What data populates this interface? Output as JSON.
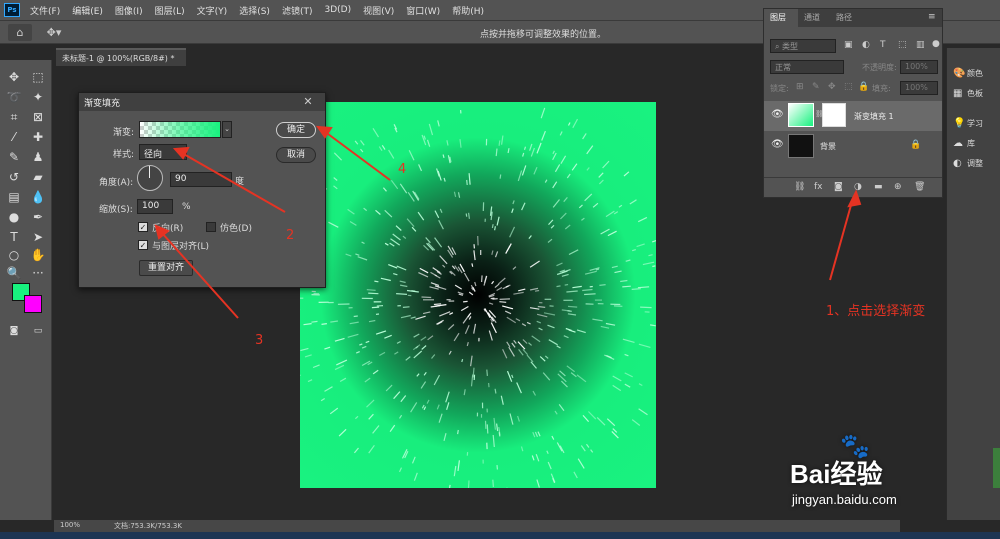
{
  "app": {
    "logo": "Ps"
  },
  "menu": [
    "文件(F)",
    "编辑(E)",
    "图像(I)",
    "图层(L)",
    "文字(Y)",
    "选择(S)",
    "滤镜(T)",
    "3D(D)",
    "视图(V)",
    "窗口(W)",
    "帮助(H)"
  ],
  "options_bar": {
    "hint": "点按并拖移可调整效果的位置。"
  },
  "document": {
    "tab": "未标题-1 @ 100%(RGB/8#) *",
    "zoom": "100%",
    "doc_size": "文档:753.3K/753.3K"
  },
  "colors": {
    "foreground": "#18f27f",
    "background": "#ff00ff",
    "annotation": "#e53323"
  },
  "dialog": {
    "title": "渐变填充",
    "gradient_label": "渐变:",
    "style_label": "样式:",
    "style_value": "径向",
    "angle_label": "角度(A):",
    "angle_value": "90",
    "angle_unit": "度",
    "scale_label": "缩放(S):",
    "scale_value": "100",
    "scale_unit": "%",
    "reverse_label": "反向(R)",
    "reverse_checked": true,
    "dither_label": "仿色(D)",
    "dither_checked": false,
    "align_label": "与图层对齐(L)",
    "align_checked": true,
    "reset_align": "重置对齐",
    "ok": "确定",
    "cancel": "取消"
  },
  "layers_panel": {
    "tabs": [
      "图层",
      "通道",
      "路径"
    ],
    "kind": "类型",
    "blend_mode": "正常",
    "opacity_label": "不透明度:",
    "opacity_value": "100%",
    "lock_label": "锁定:",
    "fill_label": "填充:",
    "fill_value": "100%",
    "layers": [
      {
        "name": "渐变填充 1"
      },
      {
        "name": "背景"
      }
    ]
  },
  "side_dock": [
    {
      "icon": "palette-icon",
      "label": "颜色"
    },
    {
      "icon": "swatches-icon",
      "label": "色板"
    },
    {
      "icon": "learn-icon",
      "label": "学习"
    },
    {
      "icon": "libraries-icon",
      "label": "库"
    },
    {
      "icon": "adjustments-icon",
      "label": "调整"
    }
  ],
  "annotations": {
    "a1": "1、点击选择渐变",
    "a2": "2",
    "a3": "3",
    "a4": "4"
  },
  "watermark": {
    "logo": "Bai经验",
    "url": "jingyan.baidu.com"
  }
}
